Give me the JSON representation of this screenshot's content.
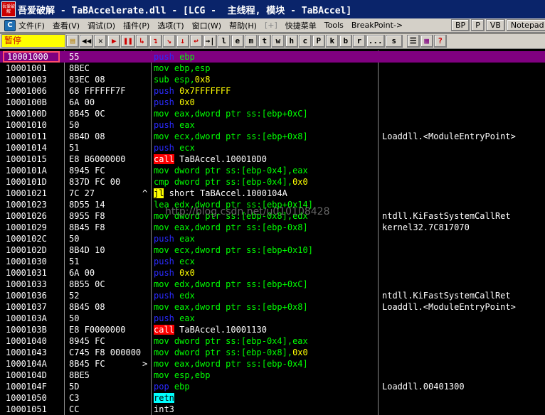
{
  "window": {
    "icon_text": "吾爱破解",
    "title": "吾爱破解 - TaBAccelerate.dll - [LCG -  主线程, 模块 - TaBAccel]"
  },
  "menu": {
    "items": [
      "文件(F)",
      "查看(V)",
      "调试(D)",
      "插件(P)",
      "选项(T)",
      "窗口(W)",
      "帮助(H)",
      "[+]",
      "快捷菜单",
      "Tools",
      "BreakPoint->"
    ],
    "right": [
      "BP",
      "P",
      "VB",
      "Notepad"
    ]
  },
  "toolbar": {
    "status": "暂停",
    "buttons": [
      "open-icon",
      "rewind-icon",
      "close-icon",
      "run-icon",
      "pause-icon",
      "step-into-icon",
      "step-over-icon",
      "trace-into-icon",
      "trace-over-icon",
      "execute-till-return-icon",
      "goto-icon"
    ],
    "letters": [
      "l",
      "e",
      "m",
      "t",
      "w",
      "h",
      "c",
      "P",
      "k",
      "b",
      "r",
      "...",
      "s"
    ],
    "right_icons": [
      "list-icon",
      "grid-icon",
      "help-icon"
    ]
  },
  "disasm": {
    "rows": [
      {
        "addr": "10001000",
        "hex": "55",
        "parts": [
          [
            "push",
            "t-b"
          ],
          [
            " ebp",
            "t-g"
          ]
        ],
        "cmt": "",
        "sel": true
      },
      {
        "addr": "10001001",
        "hex": "8BEC",
        "parts": [
          [
            "mov ebp,esp",
            "t-g"
          ]
        ],
        "cmt": ""
      },
      {
        "addr": "10001003",
        "hex": "83EC 08",
        "parts": [
          [
            "sub esp,",
            "t-g"
          ],
          [
            "0x8",
            "t-y"
          ]
        ],
        "cmt": ""
      },
      {
        "addr": "10001006",
        "hex": "68 FFFFFF7F",
        "parts": [
          [
            "push",
            "t-b"
          ],
          [
            " 0x7FFFFFFF",
            "t-y"
          ]
        ],
        "cmt": ""
      },
      {
        "addr": "1000100B",
        "hex": "6A 00",
        "parts": [
          [
            "push",
            "t-b"
          ],
          [
            " 0x0",
            "t-y"
          ]
        ],
        "cmt": ""
      },
      {
        "addr": "1000100D",
        "hex": "8B45 0C",
        "parts": [
          [
            "mov eax,dword ptr ss:[ebp+0xC]",
            "t-g"
          ]
        ],
        "cmt": ""
      },
      {
        "addr": "10001010",
        "hex": "50",
        "parts": [
          [
            "push",
            "t-b"
          ],
          [
            " eax",
            "t-g"
          ]
        ],
        "cmt": ""
      },
      {
        "addr": "10001011",
        "hex": "8B4D 08",
        "parts": [
          [
            "mov ecx,dword ptr ss:[ebp+0x8]",
            "t-g"
          ]
        ],
        "cmt": "Loaddll.<ModuleEntryPoint>"
      },
      {
        "addr": "10001014",
        "hex": "51",
        "parts": [
          [
            "push",
            "t-b"
          ],
          [
            " ecx",
            "t-g"
          ]
        ],
        "cmt": ""
      },
      {
        "addr": "10001015",
        "hex": "E8 B6000000",
        "parts": [
          [
            "call",
            "hl-red"
          ],
          [
            " TaBAccel.100010D0",
            "t-w"
          ]
        ],
        "cmt": ""
      },
      {
        "addr": "1000101A",
        "hex": "8945 FC",
        "parts": [
          [
            "mov dword ptr ss:[ebp-0x4],eax",
            "t-g"
          ]
        ],
        "cmt": ""
      },
      {
        "addr": "1000101D",
        "hex": "837D FC 00",
        "parts": [
          [
            "cmp dword ptr ss:[ebp-0x4],",
            "t-g"
          ],
          [
            "0x0",
            "t-y"
          ]
        ],
        "cmt": ""
      },
      {
        "addr": "10001021",
        "hex": "7C 27",
        "parts": [
          [
            "jl",
            "hl-yel"
          ],
          [
            " short TaBAccel.1000104A",
            "t-w"
          ]
        ],
        "cmt": "",
        "mark": "^"
      },
      {
        "addr": "10001023",
        "hex": "8D55 14",
        "parts": [
          [
            "lea edx,dword ptr ss:[ebp+0x14]",
            "t-g"
          ]
        ],
        "cmt": ""
      },
      {
        "addr": "10001026",
        "hex": "8955 F8",
        "parts": [
          [
            "mov dword ptr ss:[ebp-0x8],edx",
            "t-g"
          ]
        ],
        "cmt": "ntdll.KiFastSystemCallRet"
      },
      {
        "addr": "10001029",
        "hex": "8B45 F8",
        "parts": [
          [
            "mov eax,dword ptr ss:[ebp-0x8]",
            "t-g"
          ]
        ],
        "cmt": "kernel32.7C817070"
      },
      {
        "addr": "1000102C",
        "hex": "50",
        "parts": [
          [
            "push",
            "t-b"
          ],
          [
            " eax",
            "t-g"
          ]
        ],
        "cmt": ""
      },
      {
        "addr": "1000102D",
        "hex": "8B4D 10",
        "parts": [
          [
            "mov ecx,dword ptr ss:[ebp+0x10]",
            "t-g"
          ]
        ],
        "cmt": ""
      },
      {
        "addr": "10001030",
        "hex": "51",
        "parts": [
          [
            "push",
            "t-b"
          ],
          [
            " ecx",
            "t-g"
          ]
        ],
        "cmt": ""
      },
      {
        "addr": "10001031",
        "hex": "6A 00",
        "parts": [
          [
            "push",
            "t-b"
          ],
          [
            " 0x0",
            "t-y"
          ]
        ],
        "cmt": ""
      },
      {
        "addr": "10001033",
        "hex": "8B55 0C",
        "parts": [
          [
            "mov edx,dword ptr ss:[ebp+0xC]",
            "t-g"
          ]
        ],
        "cmt": ""
      },
      {
        "addr": "10001036",
        "hex": "52",
        "parts": [
          [
            "push",
            "t-b"
          ],
          [
            " edx",
            "t-g"
          ]
        ],
        "cmt": "ntdll.KiFastSystemCallRet"
      },
      {
        "addr": "10001037",
        "hex": "8B45 08",
        "parts": [
          [
            "mov eax,dword ptr ss:[ebp+0x8]",
            "t-g"
          ]
        ],
        "cmt": "Loaddll.<ModuleEntryPoint>"
      },
      {
        "addr": "1000103A",
        "hex": "50",
        "parts": [
          [
            "push",
            "t-b"
          ],
          [
            " eax",
            "t-g"
          ]
        ],
        "cmt": ""
      },
      {
        "addr": "1000103B",
        "hex": "E8 F0000000",
        "parts": [
          [
            "call",
            "hl-red"
          ],
          [
            " TaBAccel.10001130",
            "t-w"
          ]
        ],
        "cmt": ""
      },
      {
        "addr": "10001040",
        "hex": "8945 FC",
        "parts": [
          [
            "mov dword ptr ss:[ebp-0x4],eax",
            "t-g"
          ]
        ],
        "cmt": ""
      },
      {
        "addr": "10001043",
        "hex": "C745 F8 000000",
        "parts": [
          [
            "mov dword ptr ss:[ebp-0x8],",
            "t-g"
          ],
          [
            "0x0",
            "t-y"
          ]
        ],
        "cmt": ""
      },
      {
        "addr": "1000104A",
        "hex": "8B45 FC",
        "parts": [
          [
            "mov eax,dword ptr ss:[ebp-0x4]",
            "t-g"
          ]
        ],
        "cmt": "",
        "mark": ">"
      },
      {
        "addr": "1000104D",
        "hex": "8BE5",
        "parts": [
          [
            "mov esp,ebp",
            "t-g"
          ]
        ],
        "cmt": ""
      },
      {
        "addr": "1000104F",
        "hex": "5D",
        "parts": [
          [
            "pop",
            "t-b"
          ],
          [
            " ebp",
            "t-g"
          ]
        ],
        "cmt": "Loaddll.00401300"
      },
      {
        "addr": "10001050",
        "hex": "C3",
        "parts": [
          [
            "retn",
            "hl-cyan"
          ]
        ],
        "cmt": ""
      },
      {
        "addr": "10001051",
        "hex": "CC",
        "parts": [
          [
            "int3",
            "t-w"
          ]
        ],
        "cmt": ""
      }
    ]
  },
  "watermark": "http://blog.csdn.net/u010108428"
}
